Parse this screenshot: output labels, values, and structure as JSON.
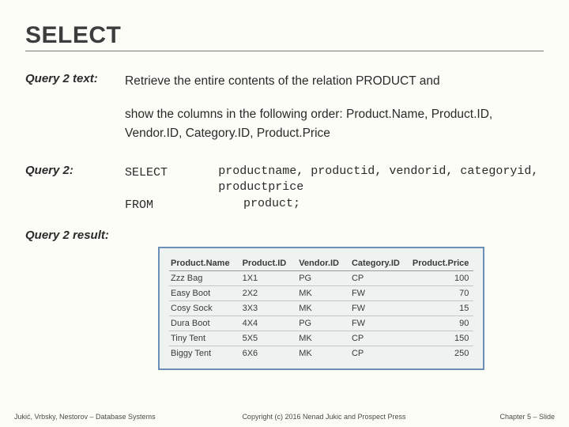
{
  "title": "SELECT",
  "query_text": {
    "label": "Query 2 text:",
    "line1": "Retrieve the entire contents of the relation PRODUCT and",
    "line2": "show the columns in the following order: Product.Name, Product.ID, Vendor.ID, Category.ID, Product.Price"
  },
  "query": {
    "label": "Query 2:",
    "select_kw": "SELECT",
    "select_cols": "productname, productid, vendorid, categoryid, productprice",
    "from_kw": "FROM",
    "from_val": "product;"
  },
  "result": {
    "label": "Query 2 result:",
    "headers": [
      "Product.Name",
      "Product.ID",
      "Vendor.ID",
      "Category.ID",
      "Product.Price"
    ],
    "rows": [
      [
        "Zzz Bag",
        "1X1",
        "PG",
        "CP",
        "100"
      ],
      [
        "Easy Boot",
        "2X2",
        "MK",
        "FW",
        "70"
      ],
      [
        "Cosy Sock",
        "3X3",
        "MK",
        "FW",
        "15"
      ],
      [
        "Dura Boot",
        "4X4",
        "PG",
        "FW",
        "90"
      ],
      [
        "Tiny Tent",
        "5X5",
        "MK",
        "CP",
        "150"
      ],
      [
        "Biggy Tent",
        "6X6",
        "MK",
        "CP",
        "250"
      ]
    ]
  },
  "footer": {
    "left": "Jukić, Vrbsky, Nestorov – Database Systems",
    "mid": "Copyright (c) 2016 Nenad Jukic and Prospect Press",
    "right": "Chapter 5 – Slide"
  }
}
